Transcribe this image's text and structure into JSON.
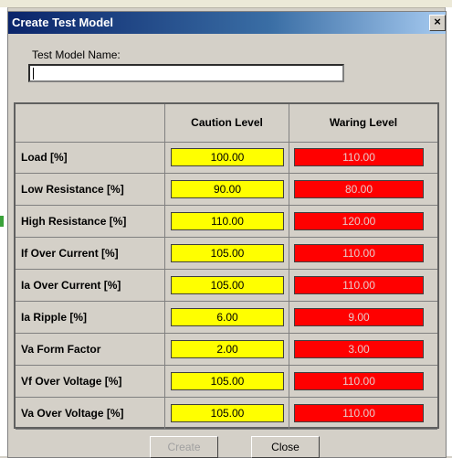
{
  "dialog": {
    "title": "Create Test Model",
    "close_glyph": "×",
    "name_label": "Test Model Name:",
    "name_value": ""
  },
  "table": {
    "headers": [
      "",
      "Caution Level",
      "Waring Level"
    ],
    "rows": [
      {
        "label": "Load [%]",
        "caution": "100.00",
        "warning": "110.00"
      },
      {
        "label": "Low Resistance [%]",
        "caution": "90.00",
        "warning": "80.00"
      },
      {
        "label": "High Resistance [%]",
        "caution": "110.00",
        "warning": "120.00"
      },
      {
        "label": "If Over Current [%]",
        "caution": "105.00",
        "warning": "110.00"
      },
      {
        "label": "Ia Over Current [%]",
        "caution": "105.00",
        "warning": "110.00"
      },
      {
        "label": "Ia Ripple [%]",
        "caution": "6.00",
        "warning": "9.00"
      },
      {
        "label": "Va Form Factor",
        "caution": "2.00",
        "warning": "3.00"
      },
      {
        "label": "Vf Over Voltage [%]",
        "caution": "105.00",
        "warning": "110.00"
      },
      {
        "label": "Va Over Voltage [%]",
        "caution": "105.00",
        "warning": "110.00"
      }
    ]
  },
  "buttons": {
    "create": "Create",
    "close": "Close"
  },
  "colors": {
    "caution": "#ffff00",
    "warning": "#ff0000",
    "titlebar": "#0a246a"
  }
}
